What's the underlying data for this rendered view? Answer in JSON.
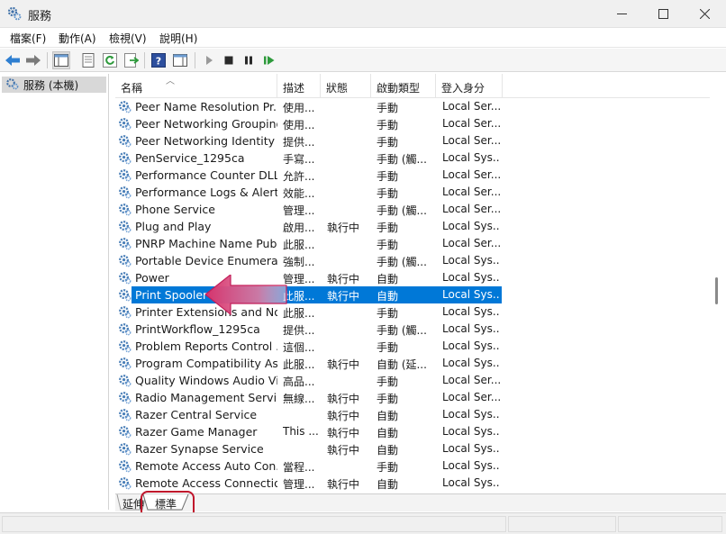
{
  "window": {
    "title": "服務"
  },
  "menu": [
    {
      "label": "檔案(F)"
    },
    {
      "label": "動作(A)"
    },
    {
      "label": "檢視(V)"
    },
    {
      "label": "說明(H)"
    }
  ],
  "tree": {
    "root_label": "服務 (本機)"
  },
  "columns": {
    "name": "名稱",
    "desc": "描述",
    "status": "狀態",
    "startup": "啟動類型",
    "logon": "登入身分"
  },
  "services": [
    {
      "name": "Peer Name Resolution Pr...",
      "desc": "使用...",
      "status": "",
      "startup": "手動",
      "logon": "Local Ser..."
    },
    {
      "name": "Peer Networking Grouping",
      "desc": "使用...",
      "status": "",
      "startup": "手動",
      "logon": "Local Ser..."
    },
    {
      "name": "Peer Networking Identity ...",
      "desc": "提供...",
      "status": "",
      "startup": "手動",
      "logon": "Local Ser..."
    },
    {
      "name": "PenService_1295ca",
      "desc": "手寫...",
      "status": "",
      "startup": "手動 (觸...",
      "logon": "Local Sys..."
    },
    {
      "name": "Performance Counter DLL ...",
      "desc": "允許...",
      "status": "",
      "startup": "手動",
      "logon": "Local Ser..."
    },
    {
      "name": "Performance Logs & Alerts",
      "desc": "效能...",
      "status": "",
      "startup": "手動",
      "logon": "Local Ser..."
    },
    {
      "name": "Phone Service",
      "desc": "管理...",
      "status": "",
      "startup": "手動 (觸...",
      "logon": "Local Ser..."
    },
    {
      "name": "Plug and Play",
      "desc": "啟用...",
      "status": "執行中",
      "startup": "手動",
      "logon": "Local Sys..."
    },
    {
      "name": "PNRP Machine Name Pub...",
      "desc": "此服...",
      "status": "",
      "startup": "手動",
      "logon": "Local Ser..."
    },
    {
      "name": "Portable Device Enumerat...",
      "desc": "強制...",
      "status": "",
      "startup": "手動 (觸...",
      "logon": "Local Sys..."
    },
    {
      "name": "Power",
      "desc": "管理...",
      "status": "執行中",
      "startup": "自動",
      "logon": "Local Sys..."
    },
    {
      "name": "Print Spooler",
      "desc": "此服...",
      "status": "執行中",
      "startup": "自動",
      "logon": "Local Sys...",
      "selected": true
    },
    {
      "name": "Printer Extensions and No...",
      "desc": "此服...",
      "status": "",
      "startup": "手動",
      "logon": "Local Sys..."
    },
    {
      "name": "PrintWorkflow_1295ca",
      "desc": "提供...",
      "status": "",
      "startup": "手動 (觸...",
      "logon": "Local Sys..."
    },
    {
      "name": "Problem Reports Control ...",
      "desc": "這個...",
      "status": "",
      "startup": "手動",
      "logon": "Local Sys..."
    },
    {
      "name": "Program Compatibility As...",
      "desc": "此服...",
      "status": "執行中",
      "startup": "自動 (延...",
      "logon": "Local Sys..."
    },
    {
      "name": "Quality Windows Audio Vi...",
      "desc": "高品...",
      "status": "",
      "startup": "手動",
      "logon": "Local Ser..."
    },
    {
      "name": "Radio Management Servi...",
      "desc": "無線...",
      "status": "執行中",
      "startup": "手動",
      "logon": "Local Ser..."
    },
    {
      "name": "Razer Central Service",
      "desc": "",
      "status": "執行中",
      "startup": "自動",
      "logon": "Local Sys..."
    },
    {
      "name": "Razer Game Manager",
      "desc": "This ...",
      "status": "執行中",
      "startup": "自動",
      "logon": "Local Sys..."
    },
    {
      "name": "Razer Synapse Service",
      "desc": "",
      "status": "執行中",
      "startup": "自動",
      "logon": "Local Sys..."
    },
    {
      "name": "Remote Access Auto Con...",
      "desc": "當程...",
      "status": "",
      "startup": "手動",
      "logon": "Local Sys..."
    },
    {
      "name": "Remote Access Connectio...",
      "desc": "管理...",
      "status": "執行中",
      "startup": "自動",
      "logon": "Local Sys..."
    }
  ],
  "tabs": [
    {
      "label": "延伸"
    },
    {
      "label": "標準",
      "active": true
    }
  ],
  "colors": {
    "selection": "#0078d7",
    "annotation_arrow": "#d6336c",
    "annotation_ring": "#c0142b"
  }
}
